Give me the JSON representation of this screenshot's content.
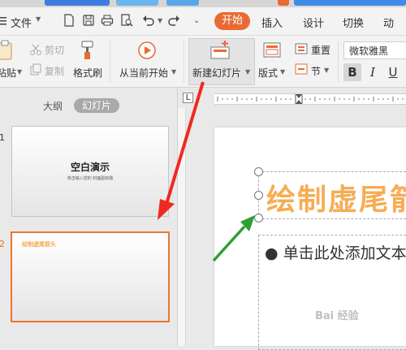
{
  "menubar": {
    "file_label": "文件",
    "tabs": [
      {
        "label": "开始"
      },
      {
        "label": "插入"
      },
      {
        "label": "设计"
      },
      {
        "label": "切换"
      },
      {
        "label": "动"
      }
    ]
  },
  "ribbon": {
    "paste": "粘贴",
    "cut": "剪切",
    "copy": "复制",
    "format_painter": "格式刷",
    "play_from_current": "从当前开始",
    "new_slide": "新建幻灯片",
    "layout": "版式",
    "reset": "重置",
    "section": "节",
    "font_name": "微软雅黑",
    "bold": "B",
    "italic": "I",
    "underline": "U"
  },
  "left_panel": {
    "tab_outline": "大纲",
    "tab_slides": "幻灯片",
    "slides": [
      {
        "number": "1",
        "title": "空白演示",
        "subtitle": "单击输入您的 封面副标题"
      },
      {
        "number": "2",
        "title": "绘制虚尾箭头"
      }
    ]
  },
  "editor": {
    "ruler_corner": "L",
    "slide_title": "绘制虚尾箭",
    "body_placeholder": "● 单击此处添加文本"
  },
  "watermark": "Bai 经验",
  "colors": {
    "accent": "#e96a32",
    "title_orange": "#f5ad54",
    "arrow_red": "#ee2a22",
    "arrow_green": "#2f9e35"
  }
}
